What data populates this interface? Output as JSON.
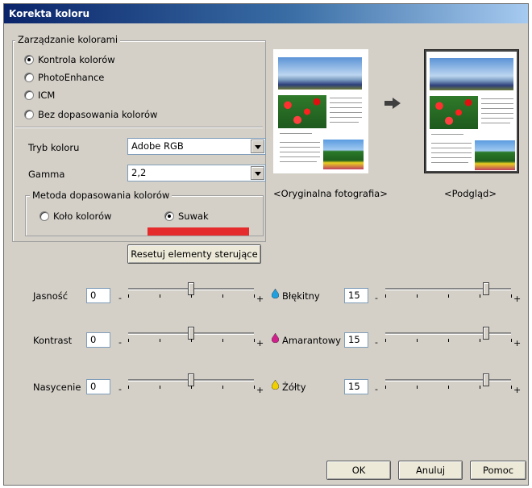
{
  "window": {
    "title": "Korekta koloru"
  },
  "color_management": {
    "group_label": "Zarządzanie kolorami",
    "options": [
      {
        "label": "Kontrola kolorów",
        "selected": true
      },
      {
        "label": "PhotoEnhance",
        "selected": false
      },
      {
        "label": "ICM",
        "selected": false
      },
      {
        "label": "Bez dopasowania kolorów",
        "selected": false
      }
    ],
    "color_mode_label": "Tryb koloru",
    "color_mode_value": "Adobe RGB",
    "gamma_label": "Gamma",
    "gamma_value": "2,2",
    "matching_method": {
      "group_label": "Metoda dopasowania kolorów",
      "options": [
        {
          "label": "Koło kolorów",
          "selected": false
        },
        {
          "label": "Suwak",
          "selected": true
        }
      ],
      "highlight_color": "#e52b2b"
    },
    "reset_button": "Resetuj elementy sterujące"
  },
  "preview": {
    "original_label": "<Oryginalna fotografia>",
    "preview_label": "<Podgląd>",
    "arrow_icon": "right-arrow-icon"
  },
  "sliders": {
    "minus": "-",
    "plus": "+",
    "left": [
      {
        "label": "Jasność",
        "value": "0",
        "level": 0.5
      },
      {
        "label": "Kontrast",
        "value": "0",
        "level": 0.5
      },
      {
        "label": "Nasycenie",
        "value": "0",
        "level": 0.5
      }
    ],
    "right": [
      {
        "label": "Błękitny",
        "value": "15",
        "level": 0.8,
        "icon": "cyan-drop-icon",
        "color": "#1ea0e0"
      },
      {
        "label": "Amarantowy",
        "value": "15",
        "level": 0.8,
        "icon": "magenta-drop-icon",
        "color": "#d0208c"
      },
      {
        "label": "Żółty",
        "value": "15",
        "level": 0.8,
        "icon": "yellow-drop-icon",
        "color": "#f0d000"
      }
    ]
  },
  "footer": {
    "ok": "OK",
    "cancel": "Anuluj",
    "help": "Pomoc"
  }
}
